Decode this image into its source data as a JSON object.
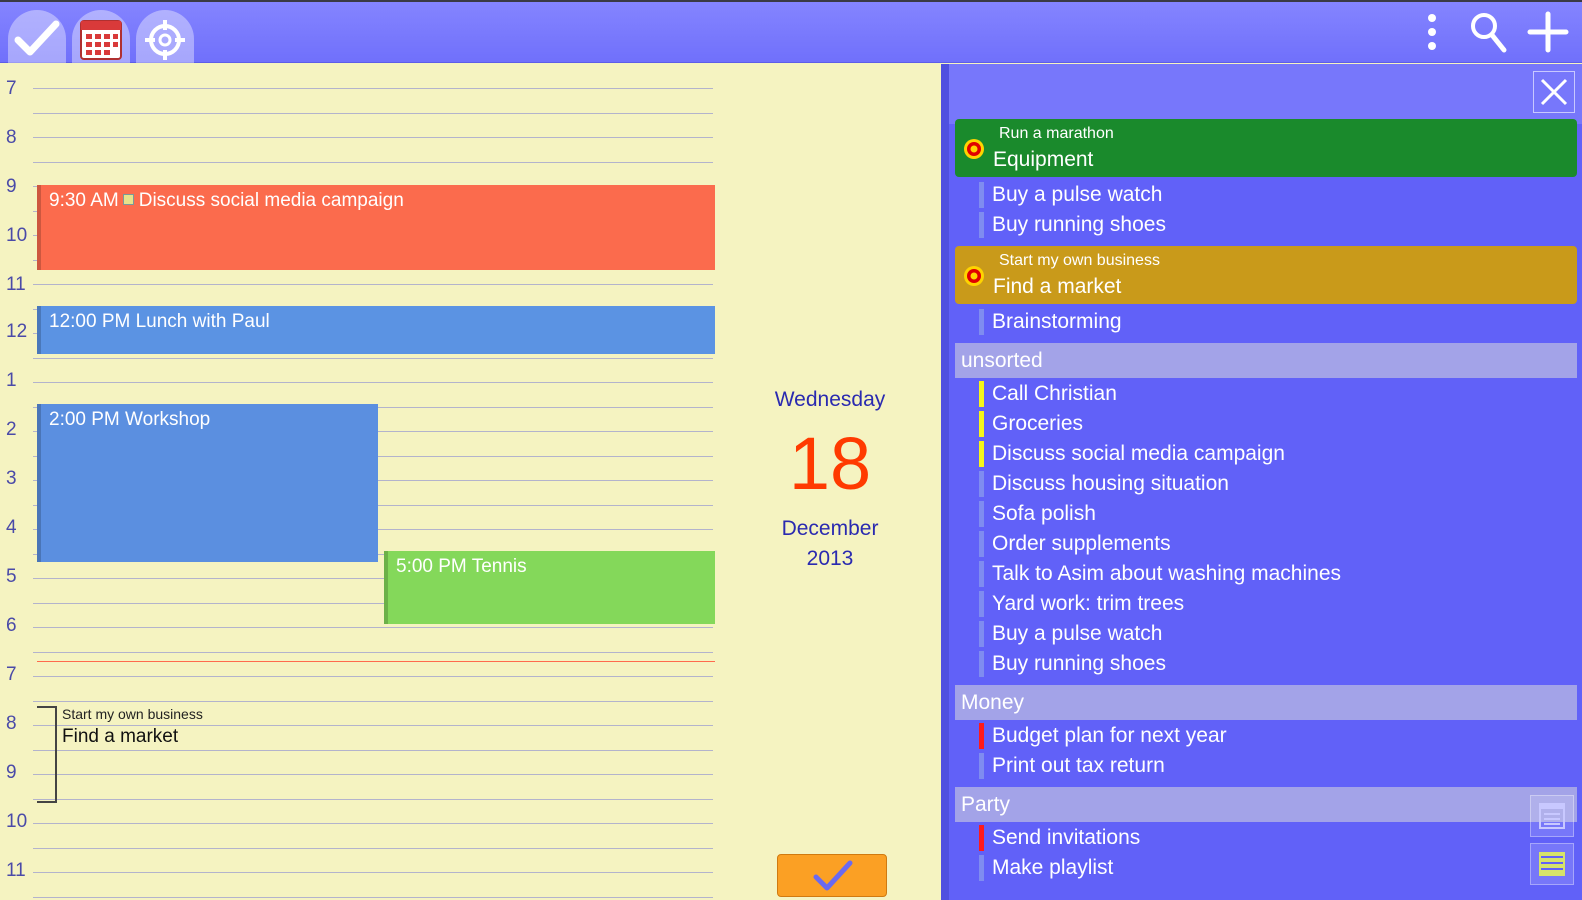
{
  "app": {
    "tabs": [
      {
        "name": "tasks-tab",
        "icon": "checkmark-icon"
      },
      {
        "name": "calendar-tab",
        "icon": "calendar-icon"
      },
      {
        "name": "goals-tab",
        "icon": "target-icon"
      }
    ],
    "actions": [
      {
        "name": "overflow-menu",
        "icon": "more-vertical-icon"
      },
      {
        "name": "search",
        "icon": "search-icon"
      },
      {
        "name": "add",
        "icon": "plus-icon"
      }
    ],
    "colors": {
      "toolbar": "#7a7afb",
      "calendar_bg": "#f5f3c1",
      "task_panel": "#6161f8",
      "accent_date": "#ff3a00"
    }
  },
  "calendar": {
    "hours": [
      "7",
      "8",
      "9",
      "10",
      "11",
      "12",
      "1",
      "2",
      "3",
      "4",
      "5",
      "6",
      "7",
      "8",
      "9",
      "10",
      "11"
    ],
    "events": [
      {
        "time": "9:30 AM",
        "title": "Discuss social media campaign",
        "color": "#fb6b4d",
        "has_task_marker": true
      },
      {
        "time": "12:00 PM",
        "title": "Lunch with Paul",
        "color": "#5b93e3"
      },
      {
        "time": "2:00 PM",
        "title": "Workshop",
        "color": "#5b8fe0"
      },
      {
        "time": "5:00 PM",
        "title": "Tennis",
        "color": "#84d85a"
      }
    ],
    "scheduled_goal": {
      "goal": "Start my own business",
      "title": "Find a market"
    }
  },
  "date": {
    "weekday": "Wednesday",
    "day": "18",
    "month": "December",
    "year": "2013"
  },
  "tasks": {
    "goals": [
      {
        "goal": "Run a marathon",
        "title": "Equipment",
        "color": "#1a8a2c",
        "items": [
          "Buy a pulse watch",
          "Buy running shoes"
        ]
      },
      {
        "goal": "Start my own business",
        "title": "Find a market",
        "color": "#c99a1a",
        "items": [
          "Brainstorming"
        ]
      }
    ],
    "groups": [
      {
        "name": "unsorted",
        "items": [
          {
            "text": "Call Christian",
            "color": "#f5f51a"
          },
          {
            "text": "Groceries",
            "color": "#f5f51a"
          },
          {
            "text": "Discuss social media campaign",
            "color": "#f5f51a"
          },
          {
            "text": "Discuss housing situation",
            "color": "#7f8cf0"
          },
          {
            "text": "Sofa polish",
            "color": "#7f8cf0"
          },
          {
            "text": "Order supplements",
            "color": "#7f8cf0"
          },
          {
            "text": "Talk to Asim about washing machines",
            "color": "#7f8cf0"
          },
          {
            "text": "Yard work: trim trees",
            "color": "#7f8cf0"
          },
          {
            "text": "Buy a pulse watch",
            "color": "#7f8cf0"
          },
          {
            "text": "Buy running shoes",
            "color": "#7f8cf0"
          }
        ]
      },
      {
        "name": "Money",
        "items": [
          {
            "text": "Budget plan for next year",
            "color": "#ff1a1a"
          },
          {
            "text": "Print out tax return",
            "color": "#7f8cf0"
          }
        ]
      },
      {
        "name": "Party",
        "items": [
          {
            "text": "Send invitations",
            "color": "#ff1a1a"
          },
          {
            "text": "Make playlist",
            "color": "#7f8cf0"
          }
        ]
      }
    ]
  }
}
